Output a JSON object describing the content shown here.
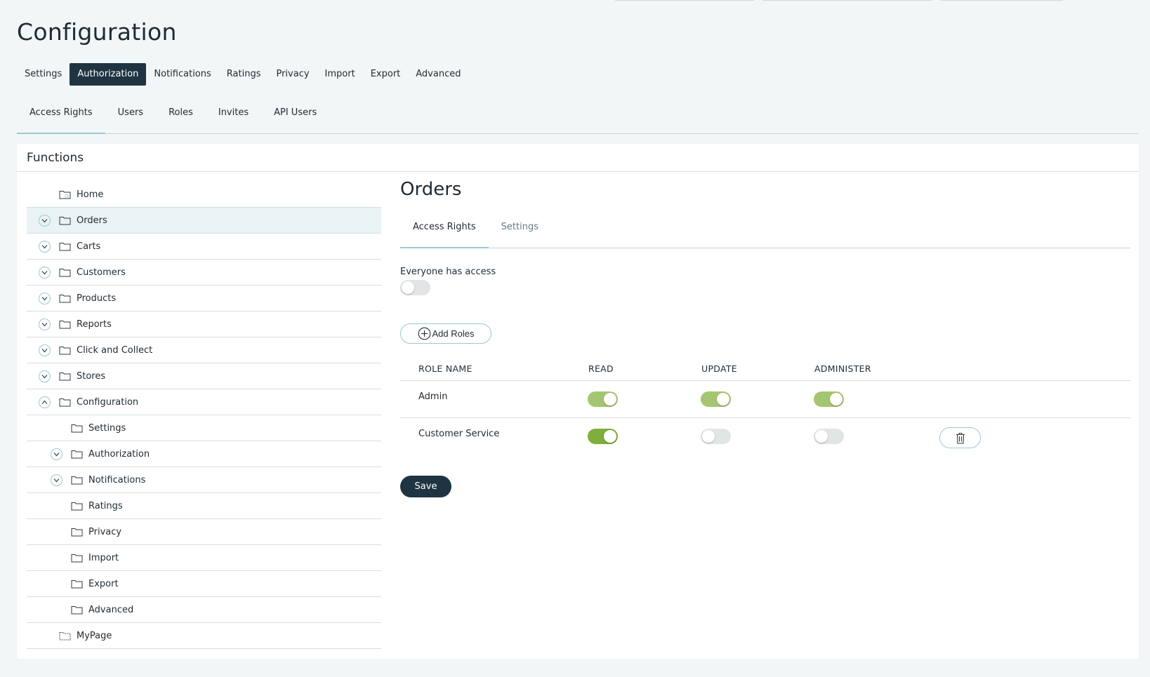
{
  "page": {
    "title": "Configuration",
    "main_tabs": [
      {
        "label": "Settings",
        "active": false
      },
      {
        "label": "Authorization",
        "active": true
      },
      {
        "label": "Notifications",
        "active": false
      },
      {
        "label": "Ratings",
        "active": false
      },
      {
        "label": "Privacy",
        "active": false
      },
      {
        "label": "Import",
        "active": false
      },
      {
        "label": "Export",
        "active": false
      },
      {
        "label": "Advanced",
        "active": false
      }
    ],
    "sub_tabs": [
      {
        "label": "Access Rights",
        "active": true
      },
      {
        "label": "Users",
        "active": false
      },
      {
        "label": "Roles",
        "active": false
      },
      {
        "label": "Invites",
        "active": false
      },
      {
        "label": "API Users",
        "active": false
      }
    ]
  },
  "functions": {
    "header": "Functions",
    "tree": [
      {
        "label": "Home",
        "level": 0,
        "chevron": "none",
        "folder": "home",
        "selected": false
      },
      {
        "label": "Orders",
        "level": 0,
        "chevron": "down",
        "folder": "normal",
        "selected": true
      },
      {
        "label": "Carts",
        "level": 0,
        "chevron": "down",
        "folder": "normal",
        "selected": false
      },
      {
        "label": "Customers",
        "level": 0,
        "chevron": "down",
        "folder": "normal",
        "selected": false
      },
      {
        "label": "Products",
        "level": 0,
        "chevron": "down",
        "folder": "normal",
        "selected": false
      },
      {
        "label": "Reports",
        "level": 0,
        "chevron": "down",
        "folder": "normal",
        "selected": false
      },
      {
        "label": "Click and Collect",
        "level": 0,
        "chevron": "down",
        "folder": "normal",
        "selected": false
      },
      {
        "label": "Stores",
        "level": 0,
        "chevron": "down",
        "folder": "normal",
        "selected": false
      },
      {
        "label": "Configuration",
        "level": 0,
        "chevron": "up",
        "folder": "normal",
        "selected": false
      },
      {
        "label": "Settings",
        "level": 1,
        "chevron": "none",
        "folder": "normal",
        "selected": false
      },
      {
        "label": "Authorization",
        "level": 1,
        "chevron": "down",
        "folder": "normal",
        "selected": false
      },
      {
        "label": "Notifications",
        "level": 1,
        "chevron": "down",
        "folder": "normal",
        "selected": false
      },
      {
        "label": "Ratings",
        "level": 1,
        "chevron": "none",
        "folder": "normal",
        "selected": false
      },
      {
        "label": "Privacy",
        "level": 1,
        "chevron": "none",
        "folder": "normal",
        "selected": false
      },
      {
        "label": "Import",
        "level": 1,
        "chevron": "none",
        "folder": "normal",
        "selected": false
      },
      {
        "label": "Export",
        "level": 1,
        "chevron": "none",
        "folder": "normal",
        "selected": false
      },
      {
        "label": "Advanced",
        "level": 1,
        "chevron": "none",
        "folder": "normal",
        "selected": false
      },
      {
        "label": "MyPage",
        "level": 0,
        "chevron": "none",
        "folder": "dashed",
        "selected": false
      }
    ]
  },
  "detail": {
    "title": "Orders",
    "tabs": [
      {
        "label": "Access Rights",
        "active": true
      },
      {
        "label": "Settings",
        "active": false
      }
    ],
    "everyone_label": "Everyone has access",
    "everyone_access": false,
    "add_roles_label": "Add Roles",
    "columns": {
      "role_name": "ROLE NAME",
      "read": "READ",
      "update": "UPDATE",
      "administer": "ADMINISTER"
    },
    "roles": [
      {
        "name": "Admin",
        "read": true,
        "update": true,
        "administer": true,
        "locked": true
      },
      {
        "name": "Customer Service",
        "read": true,
        "update": false,
        "administer": false,
        "locked": false
      }
    ],
    "save_label": "Save"
  },
  "colors": {
    "accent_dark": "#1e3442",
    "toggle_on": "#7fae3c",
    "toggle_on_locked": "#a4c672",
    "toggle_off": "#e2e5e6",
    "outline": "#9cc7d3",
    "selected_row": "#e9f3f6"
  }
}
